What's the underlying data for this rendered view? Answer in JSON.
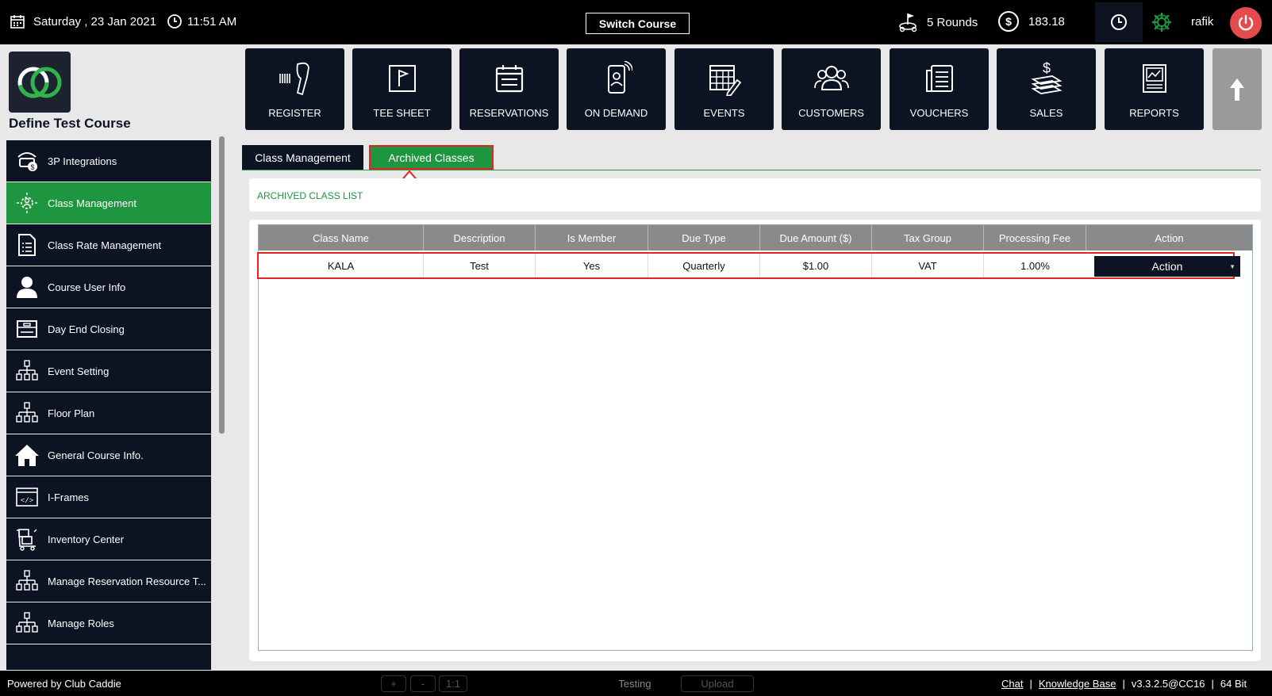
{
  "topbar": {
    "date": "Saturday ,  23 Jan 2021",
    "time": "11:51 AM",
    "switch_course": "Switch Course",
    "rounds": "5 Rounds",
    "balance": "183.18",
    "currency_symbol": "$",
    "username": "rafik"
  },
  "course": {
    "title": "Define Test Course"
  },
  "nav": [
    {
      "label": "REGISTER",
      "icon": "barcode-scanner-icon"
    },
    {
      "label": "TEE SHEET",
      "icon": "flag-icon"
    },
    {
      "label": "RESERVATIONS",
      "icon": "calendar-list-icon"
    },
    {
      "label": "ON DEMAND",
      "icon": "mobile-user-icon"
    },
    {
      "label": "EVENTS",
      "icon": "calendar-edit-icon"
    },
    {
      "label": "CUSTOMERS",
      "icon": "users-icon"
    },
    {
      "label": "VOUCHERS",
      "icon": "voucher-icon"
    },
    {
      "label": "SALES",
      "icon": "money-stack-icon"
    },
    {
      "label": "REPORTS",
      "icon": "report-chart-icon"
    }
  ],
  "sidebar": {
    "items": [
      {
        "label": "3P Integrations",
        "icon": "integration-icon"
      },
      {
        "label": "Class Management",
        "icon": "class-gear-icon",
        "active": true
      },
      {
        "label": "Class Rate Management",
        "icon": "rate-list-icon"
      },
      {
        "label": "Course User Info",
        "icon": "user-icon"
      },
      {
        "label": "Day End Closing",
        "icon": "cash-drawer-icon"
      },
      {
        "label": "Event Setting",
        "icon": "hierarchy-icon"
      },
      {
        "label": "Floor Plan",
        "icon": "hierarchy-icon"
      },
      {
        "label": "General Course Info.",
        "icon": "home-icon"
      },
      {
        "label": "I-Frames",
        "icon": "code-icon"
      },
      {
        "label": "Inventory Center",
        "icon": "inventory-cart-icon"
      },
      {
        "label": "Manage Reservation Resource T...",
        "icon": "hierarchy-icon"
      },
      {
        "label": "Manage Roles",
        "icon": "hierarchy-icon"
      }
    ]
  },
  "tabs": [
    {
      "label": "Class Management"
    },
    {
      "label": "Archived Classes",
      "active": true
    }
  ],
  "panel": {
    "title": "ARCHIVED CLASS LIST"
  },
  "grid": {
    "columns": [
      "Class Name",
      "Description",
      "Is Member",
      "Due Type",
      "Due Amount ($)",
      "Tax Group",
      "Processing Fee",
      "Action"
    ],
    "rows": [
      {
        "class_name": "KALA",
        "description": "Test",
        "is_member": "Yes",
        "due_type": "Quarterly",
        "due_amount": "$1.00",
        "tax_group": "VAT",
        "processing_fee": "1.00%",
        "action": "Action"
      }
    ]
  },
  "bottombar": {
    "powered": "Powered by Club Caddie",
    "ghost_buttons": [
      "+",
      "-",
      "1:1",
      "Testing",
      "Upload"
    ],
    "chat": "Chat",
    "separator": "|",
    "kb": "Knowledge Base",
    "version": "v3.3.2.5@CC16",
    "bits": "64 Bit"
  },
  "colors": {
    "accent_green": "#1e9640",
    "dark_navy": "#0c1322",
    "highlight_red": "#e52222",
    "power_red": "#e54b4b"
  }
}
